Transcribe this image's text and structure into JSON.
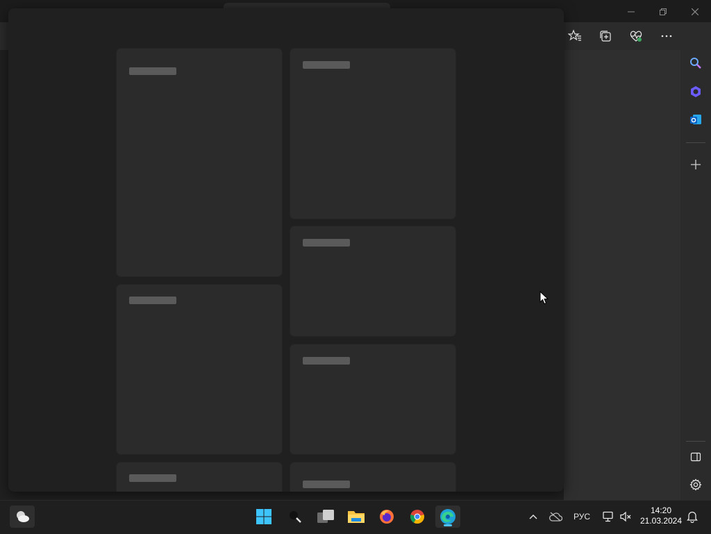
{
  "window": {
    "controls": {
      "minimize_icon": "minimize-icon",
      "restore_icon": "restore-icon",
      "close_icon": "close-icon"
    }
  },
  "toolbar": {
    "icons": [
      "favorites-icon",
      "collections-icon",
      "browser-essentials-icon",
      "more-icon",
      "copilot-icon"
    ]
  },
  "sidebar": {
    "icons": [
      "search-icon",
      "copilot-sidebar-icon",
      "outlook-icon",
      "add-icon",
      "hide-sidebar-icon",
      "settings-icon"
    ]
  },
  "taskbar": {
    "weather_icon": "weather-icon",
    "apps": [
      "start-icon",
      "search-icon",
      "task-view-icon",
      "file-explorer-icon",
      "firefox-icon",
      "chrome-icon",
      "edge-icon"
    ],
    "tray": {
      "language": "РУС",
      "time": "14:20",
      "date": "21.03.2024"
    }
  },
  "colors": {
    "accent": "#4cc2ff",
    "overlay_bg": "#202020",
    "card_bg": "#2b2b2b",
    "skeleton_bar": "#5a5a5a"
  }
}
